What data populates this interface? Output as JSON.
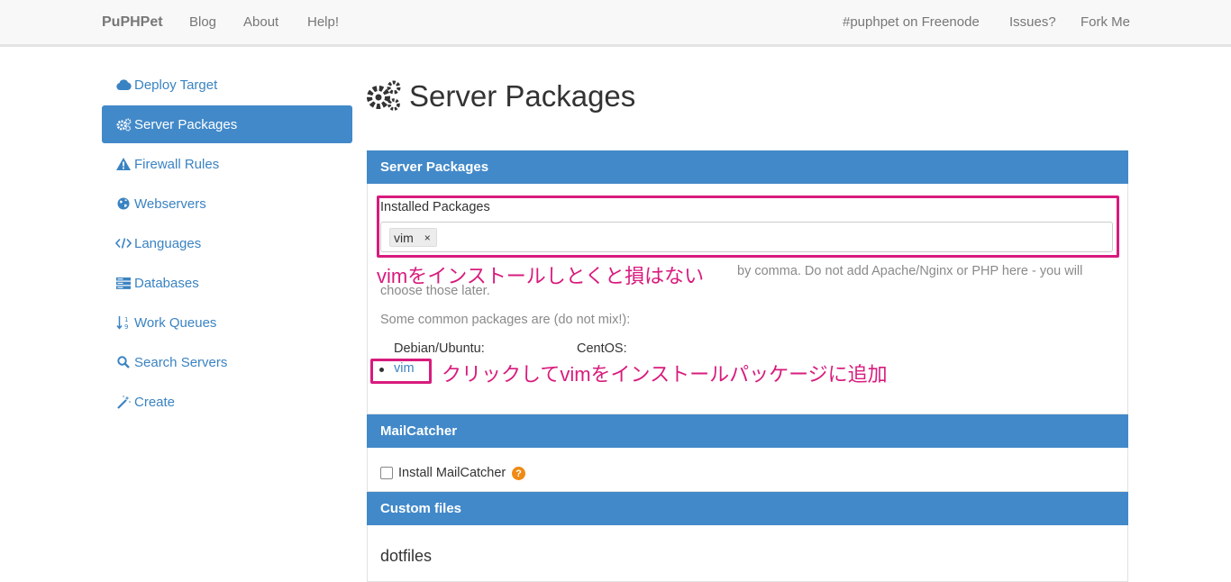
{
  "navbar": {
    "brand": "PuPHPet",
    "left_links": [
      "Blog",
      "About",
      "Help!"
    ],
    "right_links": [
      "#puphpet on Freenode",
      "Issues?",
      "Fork Me"
    ]
  },
  "sidebar": {
    "items": [
      {
        "label": "Deploy Target",
        "icon": "cloud-icon"
      },
      {
        "label": "Server Packages",
        "icon": "gears-icon",
        "active": true
      },
      {
        "label": "Firewall Rules",
        "icon": "warning-icon"
      },
      {
        "label": "Webservers",
        "icon": "globe-icon"
      },
      {
        "label": "Languages",
        "icon": "code-icon"
      },
      {
        "label": "Databases",
        "icon": "database-icon"
      },
      {
        "label": "Work Queues",
        "icon": "sort-numeric-icon"
      },
      {
        "label": "Search Servers",
        "icon": "search-icon"
      },
      {
        "label": "Create",
        "icon": "magic-wand-icon"
      }
    ]
  },
  "main": {
    "title": "Server Packages",
    "server_packages_panel": {
      "heading": "Server Packages",
      "installed_label": "Installed Packages",
      "installed_tags": [
        "vim"
      ],
      "tag_remove": "×",
      "help_text_tail": "by comma. Do not add Apache/Nginx or PHP here - you will",
      "help_text_line2": "choose those later.",
      "common_label": "Some common packages are (do not mix!):",
      "debian_label": "Debian/Ubuntu:",
      "centos_label": "CentOS:",
      "debian_packages": [
        "vim"
      ]
    },
    "mailcatcher_panel": {
      "heading": "MailCatcher",
      "checkbox_label": "Install MailCatcher",
      "checked": false,
      "help": "?"
    },
    "custom_files_panel": {
      "heading": "Custom files",
      "dotfiles_title": "dotfiles"
    }
  },
  "annotations": {
    "installed_note": "vimをインストールしとくと損はない",
    "click_note": "クリックしてvimをインストールパッケージに追加"
  },
  "colors": {
    "accent": "#4289c9",
    "link": "#3a83c2",
    "annotation": "#d81b7d",
    "help_badge": "#ef8a13"
  }
}
